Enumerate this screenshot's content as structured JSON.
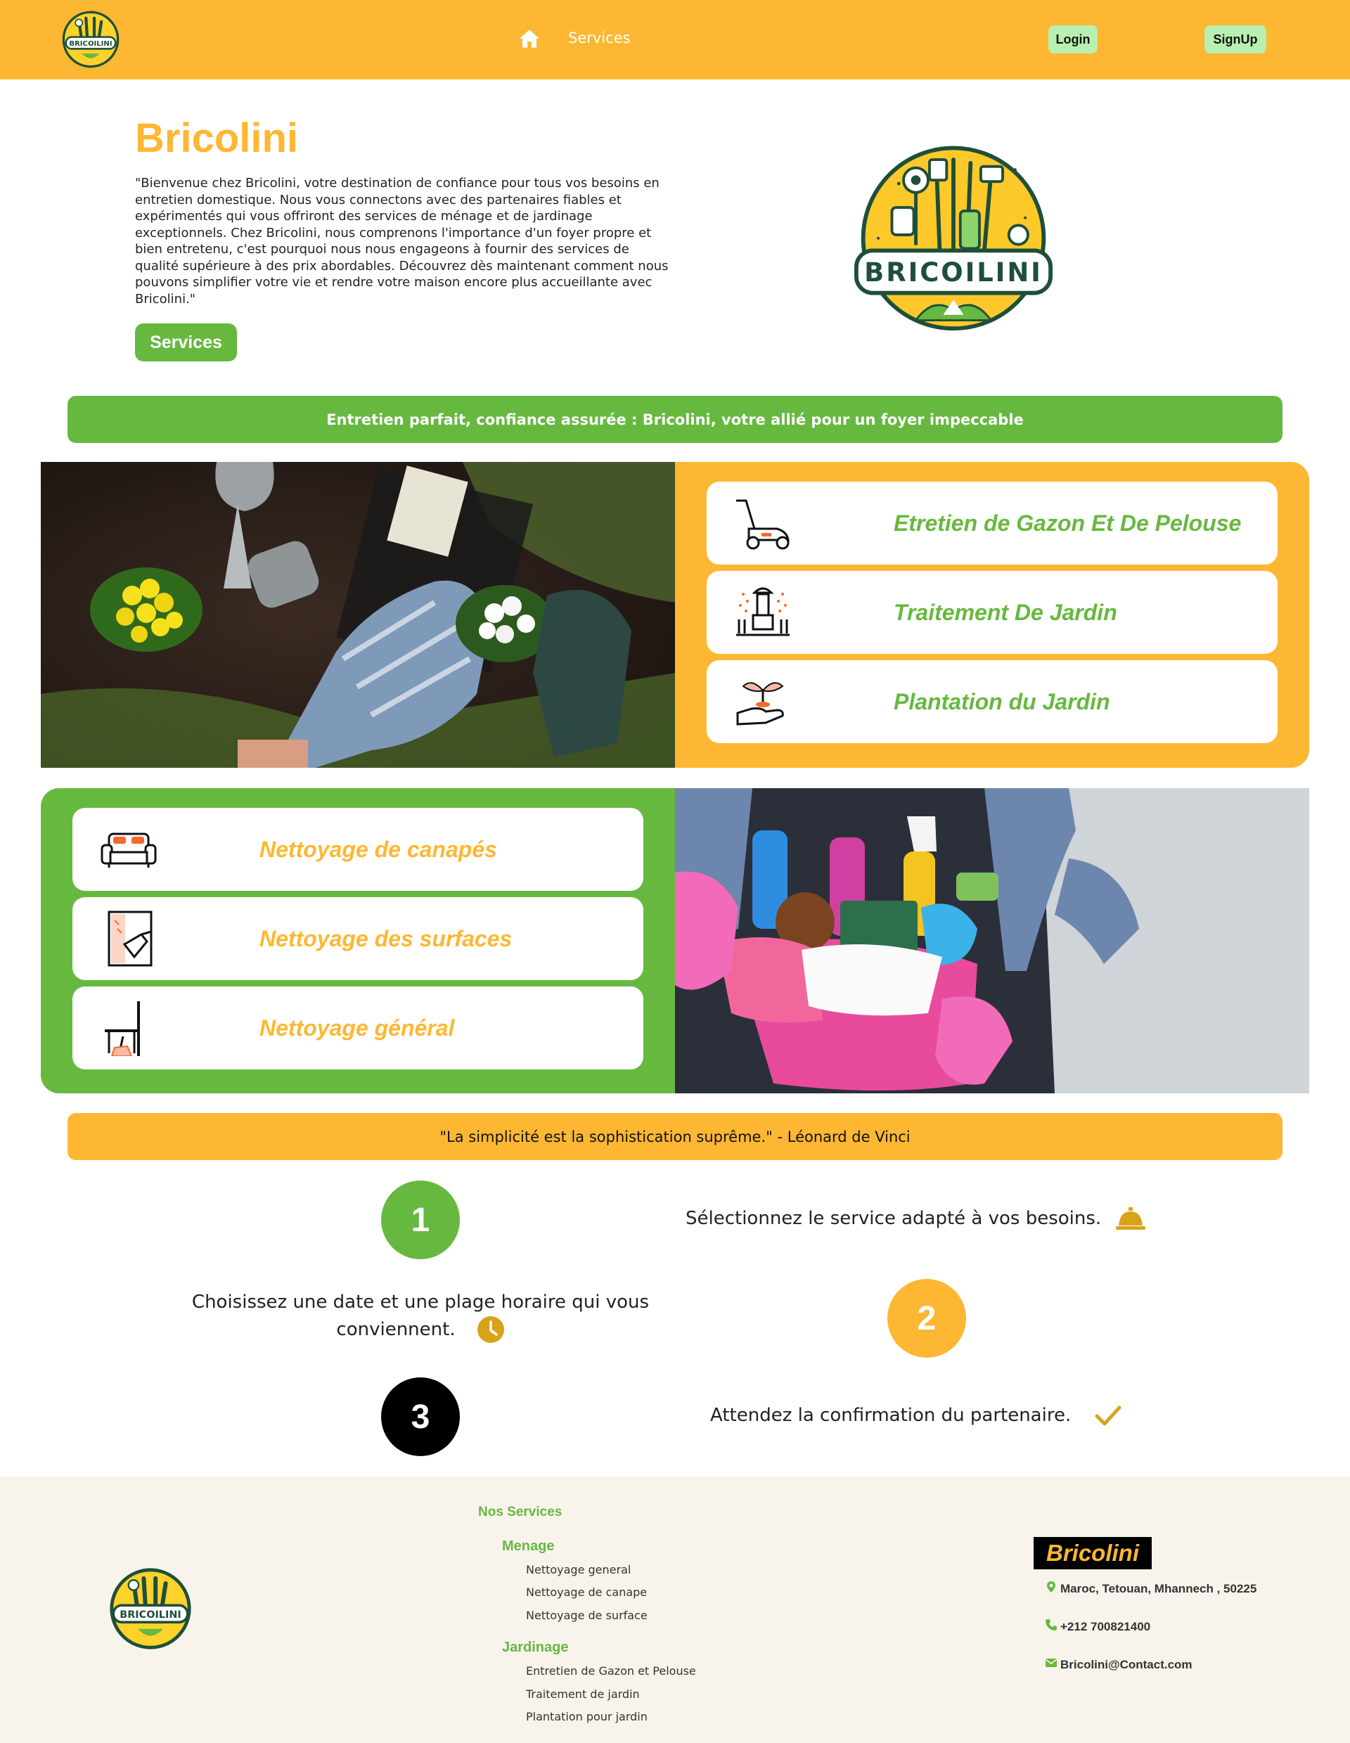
{
  "colors": {
    "orange": "#fdb733",
    "green": "#67b83f",
    "login_bg": "#b9efb0",
    "footer_bg": "#f8f4ec"
  },
  "nav": {
    "logo_text": "BRICOILINI",
    "home_icon": "home-icon",
    "services_label": "Services",
    "login_label": "Login",
    "signup_label": "SignUp"
  },
  "hero": {
    "title": "Bricolini",
    "description": "\"Bienvenue chez Bricolini, votre destination de confiance pour tous vos besoins en entretien domestique. Nous vous connectons avec des partenaires fiables et expérimentés qui vous offriront des services de ménage et de jardinage exceptionnels. Chez Bricolini, nous comprenons l'importance d'un foyer propre et bien entretenu, c'est pourquoi nous nous engageons à fournir des services de qualité supérieure à des prix abordables. Découvrez dès maintenant comment nous pouvons simplifier votre vie et rendre votre maison encore plus accueillante avec Bricolini.\"",
    "services_button": "Services",
    "logo_text": "BRICOILINI"
  },
  "banner_tagline": "Entretien parfait, confiance assurée : Bricolini, votre allié pour un foyer impeccable",
  "garden_services": [
    {
      "label": "Etretien de Gazon Et De Pelouse",
      "icon": "lawn-mower-icon"
    },
    {
      "label": "Traitement De Jardin",
      "icon": "sprinkler-icon"
    },
    {
      "label": "Plantation du Jardin",
      "icon": "plant-in-hand-icon"
    }
  ],
  "cleaning_services": [
    {
      "label": "Nettoyage de canapés",
      "icon": "sofa-icon"
    },
    {
      "label": "Nettoyage des surfaces",
      "icon": "surface-cleaning-icon"
    },
    {
      "label": "Nettoyage général",
      "icon": "broom-cleaning-icon"
    }
  ],
  "quote": "\"La simplicité est la sophistication suprême.\" - Léonard de Vinci",
  "steps": [
    {
      "number": "1",
      "text": "Sélectionnez le service adapté à vos besoins.",
      "icon": "service-bell-icon",
      "color": "#67b83f"
    },
    {
      "number": "2",
      "text_line1": "Choisissez une date et une plage horaire qui vous",
      "text_line2": "conviennent.",
      "icon": "clock-icon",
      "color": "#fdb733"
    },
    {
      "number": "3",
      "text": "Attendez la confirmation du partenaire.",
      "icon": "check-icon",
      "color": "#000000"
    }
  ],
  "footer": {
    "logo_text": "BRICOILINI",
    "services_heading": "Nos Services",
    "menage_heading": "Menage",
    "menage_items": [
      "Nettoyage general",
      "Nettoyage de canape",
      "Nettoyage de surface"
    ],
    "jardinage_heading": "Jardinage",
    "jardinage_items": [
      "Entretien de Gazon et Pelouse",
      "Traitement de jardin",
      "Plantation pour jardin"
    ],
    "brand": "Bricolini",
    "address": "Maroc, Tetouan, Mhannech , 50225",
    "phone": "+212 700821400",
    "email": "Bricolini@Contact.com"
  }
}
